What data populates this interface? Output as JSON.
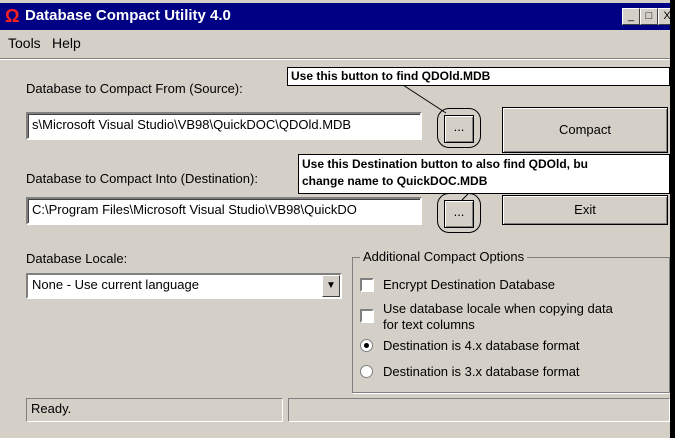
{
  "window": {
    "title": "Database Compact Utility 4.0",
    "minimize": "_",
    "maximize": "□",
    "close": "X"
  },
  "menu": {
    "tools": "Tools",
    "help": "Help"
  },
  "source": {
    "label": "Database to Compact From (Source):",
    "value": "s\\Microsoft Visual Studio\\VB98\\QuickDOC\\QDOld.MDB",
    "browse": "..."
  },
  "destination": {
    "label": "Database to Compact Into (Destination):",
    "value": "C:\\Program Files\\Microsoft Visual Studio\\VB98\\QuickDO",
    "browse": "..."
  },
  "buttons": {
    "compact": "Compact",
    "exit": "Exit"
  },
  "callouts": {
    "source": "Use this button to find QDOld.MDB",
    "dest_line1": "Use this Destination button to also find QDOld, bu",
    "dest_line2": "change name to QuickDOC.MDB"
  },
  "locale": {
    "label": "Database Locale:",
    "value": "None - Use current language"
  },
  "options": {
    "title": "Additional Compact Options",
    "encrypt": "Encrypt Destination Database",
    "use_locale_1": "Use database locale when copying data",
    "use_locale_2": "for text columns",
    "format4": "Destination is 4.x database format",
    "format3": "Destination is 3.x database format",
    "encrypt_checked": false,
    "use_locale_checked": false,
    "selected_format": "4.x"
  },
  "status": {
    "text": "Ready.",
    "panel2": ""
  }
}
